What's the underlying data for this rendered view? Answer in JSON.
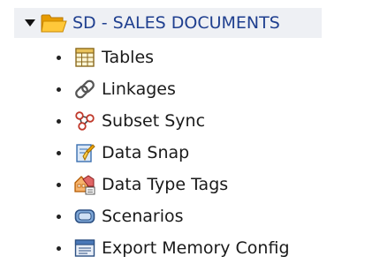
{
  "tree": {
    "root": {
      "label": "SD - SALES DOCUMENTS",
      "expanded": true,
      "icon": "folder-open-icon"
    },
    "items": [
      {
        "label": "Tables",
        "icon": "table-icon"
      },
      {
        "label": "Linkages",
        "icon": "link-icon"
      },
      {
        "label": "Subset Sync",
        "icon": "subset-sync-icon"
      },
      {
        "label": "Data Snap",
        "icon": "data-snap-icon"
      },
      {
        "label": "Data Type Tags",
        "icon": "data-type-tags-icon"
      },
      {
        "label": "Scenarios",
        "icon": "scenarios-icon"
      },
      {
        "label": "Export Memory Config",
        "icon": "export-memory-config-icon"
      }
    ]
  },
  "colors": {
    "root_text": "#1f3f8f",
    "root_row_bg": "#eef0f4",
    "folder": "#f2a900"
  }
}
